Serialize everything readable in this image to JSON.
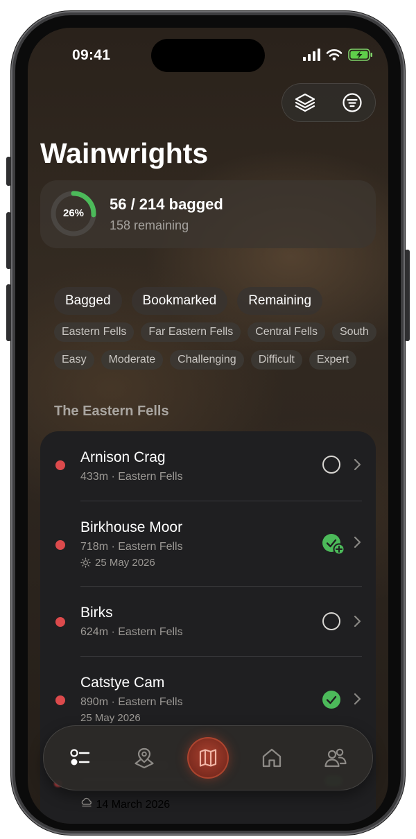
{
  "status_bar": {
    "time": "09:41"
  },
  "header": {
    "title": "Wainwrights"
  },
  "progress": {
    "percent_label": "26%",
    "fraction": 0.26,
    "bagged_text": "56 / 214 bagged",
    "remaining_text": "158 remaining"
  },
  "status_filters": [
    "Bagged",
    "Bookmarked",
    "Remaining"
  ],
  "region_filters": [
    "Eastern Fells",
    "Far Eastern Fells",
    "Central Fells",
    "South"
  ],
  "difficulty_filters": [
    "Easy",
    "Moderate",
    "Challenging",
    "Difficult",
    "Expert"
  ],
  "section": {
    "title": "The Eastern Fells"
  },
  "fells": [
    {
      "name": "Arnison Crag",
      "meta": "433m · Eastern Fells",
      "date": "",
      "status": "unbagged"
    },
    {
      "name": "Birkhouse Moor",
      "meta": "718m · Eastern Fells",
      "date": "25 May 2026",
      "status": "bagged-plus",
      "date_icon": "sun-icon"
    },
    {
      "name": "Birks",
      "meta": "624m · Eastern Fells",
      "date": "",
      "status": "unbagged"
    },
    {
      "name": "Catstye Cam",
      "meta": "890m · Eastern Fells",
      "date": "25 May 2026",
      "status": "bagged"
    }
  ],
  "peek_row": {
    "date": "14 March 2026",
    "date_icon": "cloud-icon"
  },
  "tabbar": {
    "tabs": [
      "list-icon",
      "map-pin-icon",
      "map-icon",
      "home-icon",
      "people-icon"
    ],
    "active": "map-icon"
  },
  "colors": {
    "accent_red": "#dc4a4c",
    "success_green": "#4cba5a",
    "tab_active": "#a8402e"
  }
}
